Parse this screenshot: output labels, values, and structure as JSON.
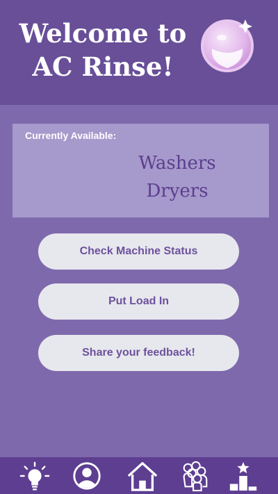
{
  "header": {
    "title_line1": "Welcome to",
    "title_line2": "AC Rinse!",
    "logo_icon": "crystal-ball-icon"
  },
  "availability": {
    "label": "Currently Available:",
    "items": [
      "Washers",
      "Dryers"
    ]
  },
  "actions": [
    {
      "label": "Check Machine Status"
    },
    {
      "label": "Put Load In"
    },
    {
      "label": "Share your feedback!"
    }
  ],
  "nav": [
    {
      "icon": "lightbulb-icon"
    },
    {
      "icon": "profile-icon"
    },
    {
      "icon": "home-icon"
    },
    {
      "icon": "group-icon"
    },
    {
      "icon": "leaderboard-icon"
    }
  ],
  "colors": {
    "header_bg": "#684f98",
    "body_bg": "#7f69ad",
    "panel_bg": "#a699cb",
    "button_bg": "#e7e8ed",
    "button_text": "#6d519d",
    "nav_bg": "#5d3e91"
  }
}
